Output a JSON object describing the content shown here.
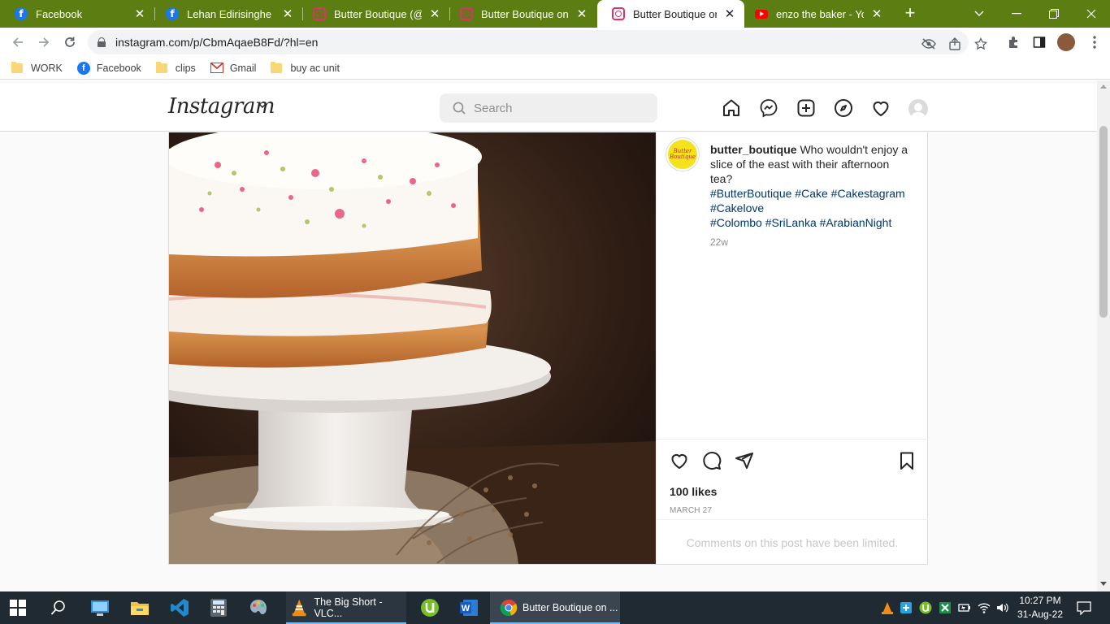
{
  "browser": {
    "tabs": [
      {
        "title": "Facebook",
        "favicon": "facebook-icon"
      },
      {
        "title": "Lehan Edirisinghe | Fa",
        "favicon": "facebook-icon"
      },
      {
        "title": "Butter Boutique (@bu",
        "favicon": "instagram-icon"
      },
      {
        "title": "Butter Boutique on In",
        "favicon": "instagram-icon"
      },
      {
        "title": "Butter Boutique on In",
        "favicon": "instagram-icon",
        "active": true
      },
      {
        "title": "enzo the baker - YouT",
        "favicon": "youtube-icon"
      }
    ],
    "close_glyph": "✕",
    "url": "instagram.com/p/CbmAqaeB8Fd/?hl=en",
    "bookmarks": [
      {
        "label": "WORK",
        "icon": "folder-icon"
      },
      {
        "label": "Facebook",
        "icon": "facebook-icon"
      },
      {
        "label": "clips",
        "icon": "folder-icon"
      },
      {
        "label": "Gmail",
        "icon": "gmail-icon"
      },
      {
        "label": "buy ac unit",
        "icon": "folder-icon"
      }
    ],
    "tab_strip_color": "#5b7d12"
  },
  "instagram": {
    "logo": "Instagram",
    "search_placeholder": "Search",
    "post": {
      "username": "butter_boutique",
      "avatar_text": "Butter Boutique",
      "caption_text": "Who wouldn't enjoy a slice of the east with their afternoon tea?",
      "hashtags_line1": "#ButterBoutique #Cake #Cakestagram #Cakelove",
      "hashtags_line2": "#Colombo #SriLanka #ArabianNight",
      "age": "22w",
      "likes": "100 likes",
      "date": "MARCH 27",
      "comments_limited": "Comments on this post have been limited.",
      "image_alt": "layered sponge cake with cream frosting topped with rose petals and pistachios on a white cake stand"
    },
    "link_color": "#00376b"
  },
  "taskbar": {
    "apps": [
      {
        "name": "vlc",
        "label": "The Big Short - VLC..."
      },
      {
        "name": "chrome",
        "label": "Butter Boutique on ..."
      }
    ],
    "time": "10:27 PM",
    "date": "31-Aug-22"
  }
}
